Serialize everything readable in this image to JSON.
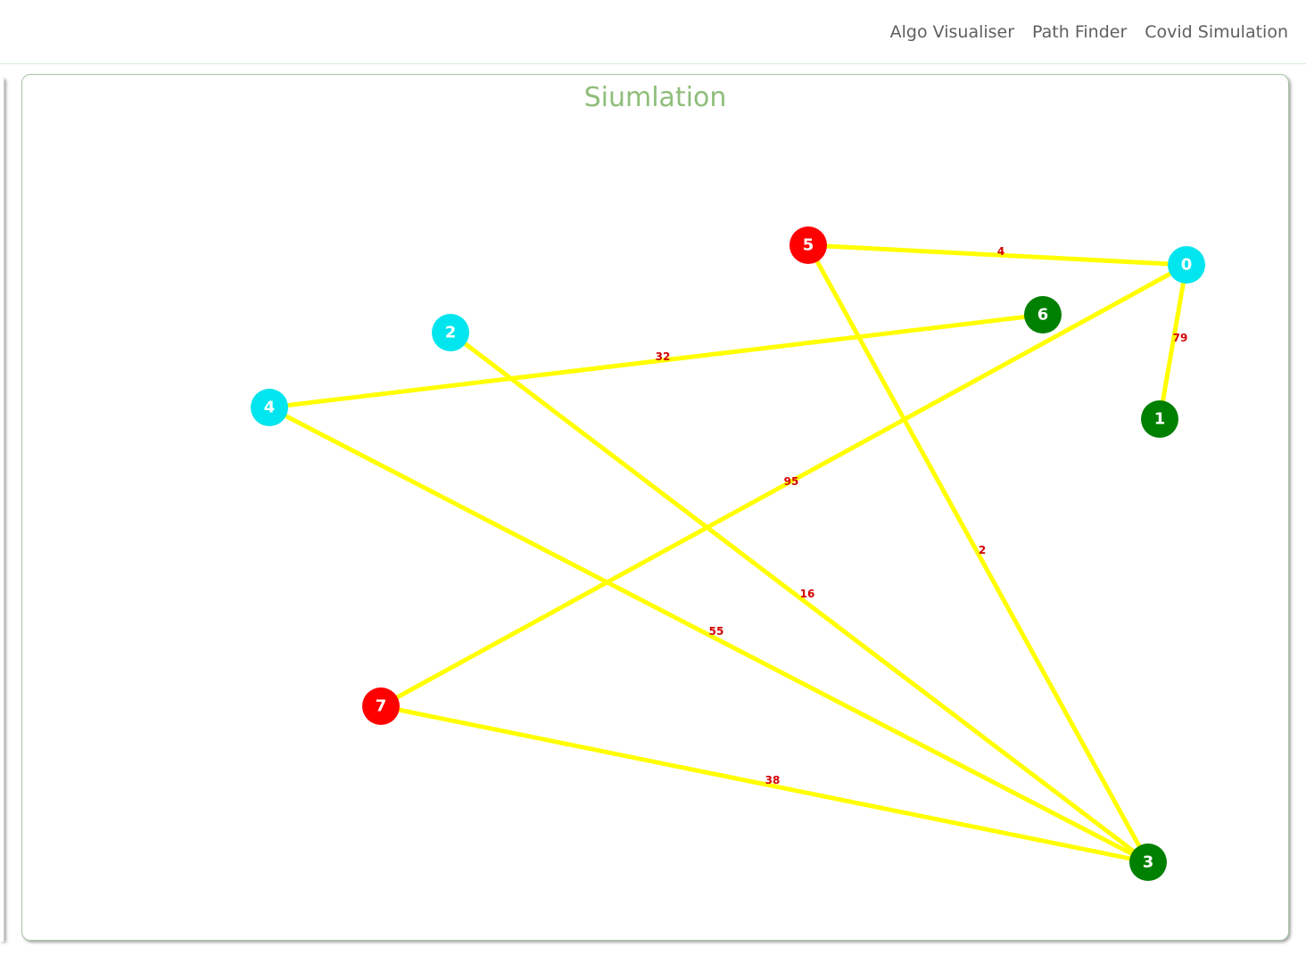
{
  "nav": {
    "items": [
      {
        "label": "Algo Visualiser"
      },
      {
        "label": "Path Finder"
      },
      {
        "label": "Covid Simulation"
      }
    ]
  },
  "simulation": {
    "title": "Siumlation",
    "colors": {
      "edge": "#ffff00",
      "edge_weight": "#d40000",
      "infected": "#ff0000",
      "healthy": "#008000",
      "neutral": "#00e5ee",
      "node_text": "#ffffff"
    },
    "nodes": [
      {
        "id": "0",
        "status": "neutral"
      },
      {
        "id": "1",
        "status": "healthy"
      },
      {
        "id": "2",
        "status": "neutral"
      },
      {
        "id": "3",
        "status": "healthy"
      },
      {
        "id": "4",
        "status": "neutral"
      },
      {
        "id": "5",
        "status": "infected"
      },
      {
        "id": "6",
        "status": "healthy"
      },
      {
        "id": "7",
        "status": "infected"
      }
    ],
    "edges": [
      {
        "from": "5",
        "to": "0",
        "weight": "4"
      },
      {
        "from": "0",
        "to": "1",
        "weight": "79"
      },
      {
        "from": "4",
        "to": "6",
        "weight": "32"
      },
      {
        "from": "0",
        "to": "7",
        "weight": "95"
      },
      {
        "from": "5",
        "to": "3",
        "weight": "2"
      },
      {
        "from": "2",
        "to": "3",
        "weight": "16"
      },
      {
        "from": "4",
        "to": "3",
        "weight": "55"
      },
      {
        "from": "7",
        "to": "3",
        "weight": "38"
      }
    ]
  }
}
